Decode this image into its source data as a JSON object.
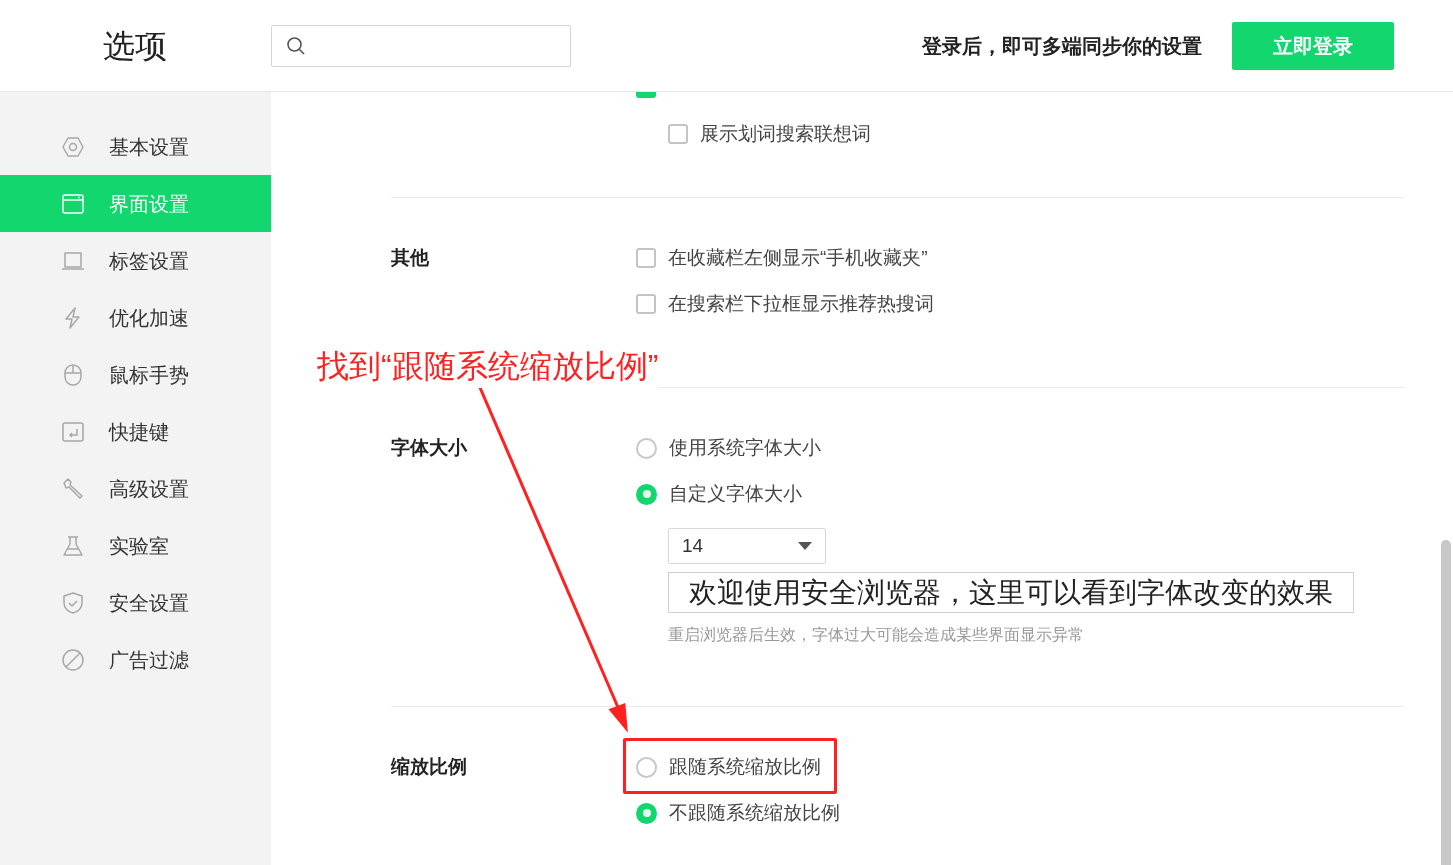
{
  "window": {
    "title": "选项"
  },
  "header": {
    "login_prompt": "登录后，即可多端同步你的设置",
    "login_button": "立即登录"
  },
  "sidebar": {
    "items": [
      {
        "label": "基本设置",
        "selected": false
      },
      {
        "label": "界面设置",
        "selected": true
      },
      {
        "label": "标签设置",
        "selected": false
      },
      {
        "label": "优化加速",
        "selected": false
      },
      {
        "label": "鼠标手势",
        "selected": false
      },
      {
        "label": "快捷键",
        "selected": false
      },
      {
        "label": "高级设置",
        "selected": false
      },
      {
        "label": "实验室",
        "selected": false
      },
      {
        "label": "安全设置",
        "selected": false
      },
      {
        "label": "广告过滤",
        "selected": false
      }
    ]
  },
  "sections": [
    {
      "options": [
        {
          "kind": "checkbox",
          "checked": true,
          "children": [
            {
              "kind": "checkbox",
              "label": "展示划词搜索联想词",
              "checked": false
            }
          ]
        }
      ]
    },
    {
      "label": "其他",
      "options": [
        {
          "kind": "checkbox",
          "label": "在收藏栏左侧显示“手机收藏夹”",
          "checked": false
        },
        {
          "kind": "checkbox",
          "label": "在搜索栏下拉框显示推荐热搜词",
          "checked": false
        }
      ]
    },
    {
      "label": "字体大小",
      "options": [
        {
          "kind": "radio",
          "label": "使用系统字体大小",
          "selected": false
        },
        {
          "kind": "radio",
          "label": "自定义字体大小",
          "selected": true,
          "children": [
            {
              "kind": "select",
              "value": "14"
            },
            {
              "kind": "preview",
              "text": "欢迎使用安全浏览器，这里可以看到字体改变的效果"
            },
            {
              "kind": "hint",
              "text": "重启浏览器后生效，字体过大可能会造成某些界面显示异常"
            }
          ]
        }
      ]
    },
    {
      "label": "缩放比例",
      "options": [
        {
          "kind": "radio",
          "label": "跟随系统缩放比例",
          "selected": false,
          "highlighted": true
        },
        {
          "kind": "radio",
          "label": "不跟随系统缩放比例",
          "selected": true
        }
      ]
    }
  ],
  "annotation": {
    "text": "找到“跟随系统缩放比例”"
  }
}
